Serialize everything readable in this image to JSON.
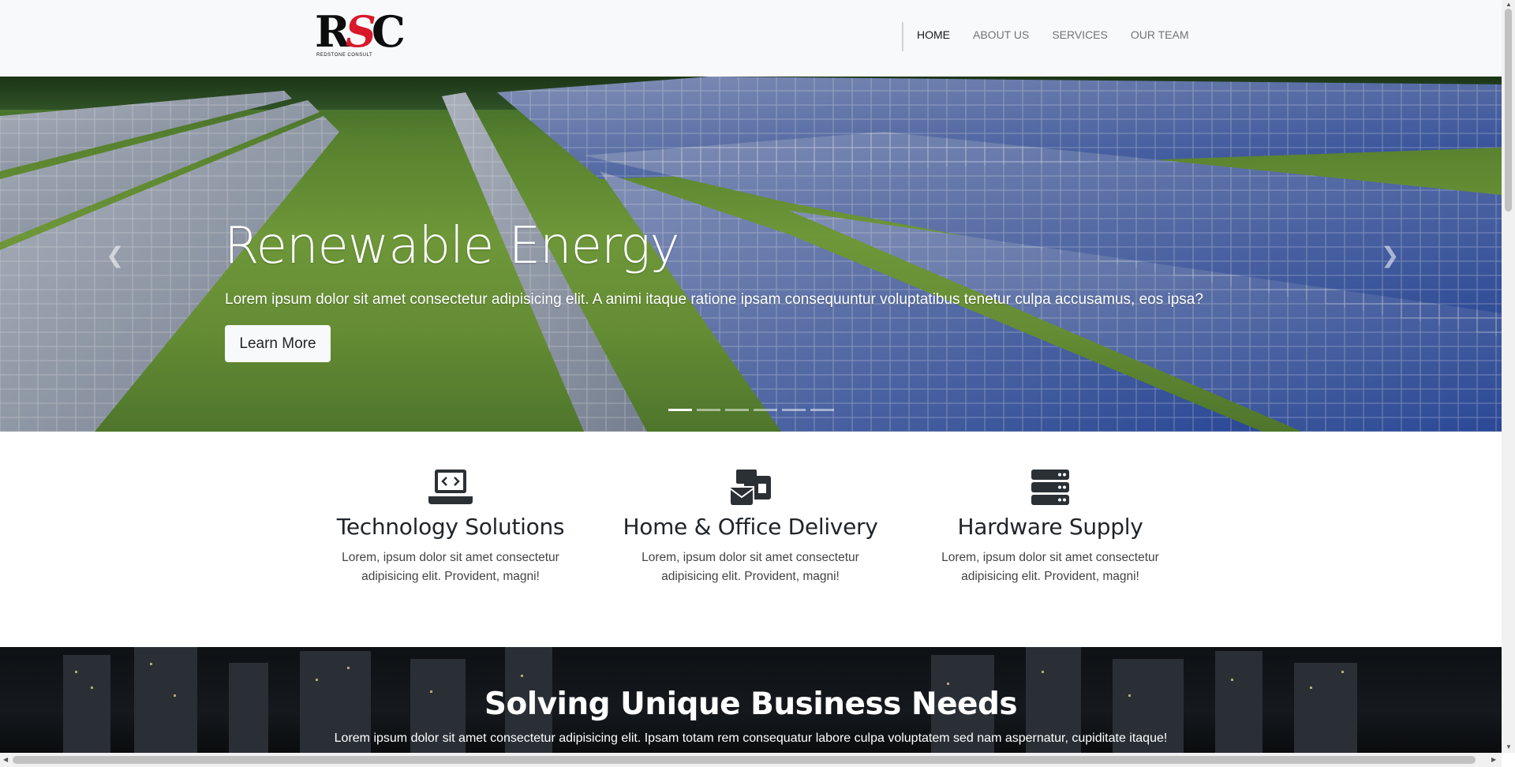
{
  "brand": {
    "logo_text_left": "R",
    "logo_text_mid": "S",
    "logo_text_right": "C",
    "logo_subtext": "REDSTONE CONSULT"
  },
  "nav": {
    "items": [
      {
        "label": "HOME",
        "active": true
      },
      {
        "label": "ABOUT US",
        "active": false
      },
      {
        "label": "SERVICES",
        "active": false
      },
      {
        "label": "OUR TEAM",
        "active": false
      }
    ]
  },
  "hero": {
    "title": "Renewable Energy",
    "text": "Lorem ipsum dolor sit amet consectetur adipisicing elit. A animi itaque ratione ipsam consequuntur voluptatibus tenetur culpa accusamus, eos ipsa?",
    "button_label": "Learn More",
    "prev_icon": "chevron-left-icon",
    "next_icon": "chevron-right-icon",
    "slide_count": 6,
    "active_slide": 1
  },
  "features": [
    {
      "icon": "laptop-code-icon",
      "title": "Technology Solutions",
      "text_line1": "Lorem, ipsum dolor sit amet consectetur",
      "text_line2": "adipisicing elit. Provident, magni!"
    },
    {
      "icon": "envelopes-icon",
      "title": "Home & Office Delivery",
      "text_line1": "Lorem, ipsum dolor sit amet consectetur",
      "text_line2": "adipisicing elit. Provident, magni!"
    },
    {
      "icon": "server-icon",
      "title": "Hardware Supply",
      "text_line1": "Lorem, ipsum dolor sit amet consectetur",
      "text_line2": "adipisicing elit. Provident, magni!"
    }
  ],
  "business": {
    "title": "Solving Unique Business Needs",
    "text": "Lorem ipsum dolor sit amet consectetur adipisicing elit. Ipsam totam rem consequatur labore culpa voluptatem sed nam aspernatur, cupiditate itaque!"
  },
  "colors": {
    "navbar_bg": "#f8f9fa",
    "logo_red": "#d9182a",
    "icon_dark": "#2b3035",
    "dark_section_bg": "#111518"
  }
}
